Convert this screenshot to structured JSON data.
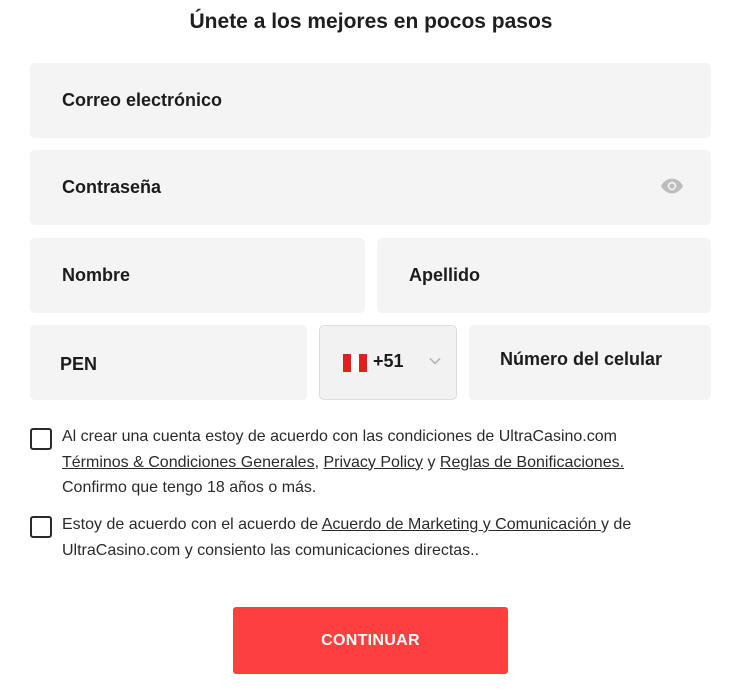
{
  "header": {
    "title": "Únete a los mejores en pocos pasos"
  },
  "form": {
    "email_placeholder": "Correo electrónico",
    "password_placeholder": "Contraseña",
    "first_name_placeholder": "Nombre",
    "last_name_placeholder": "Apellido",
    "currency_value": "PEN",
    "phone_country_code": "+51",
    "phone_country_flag": "peru-flag-icon",
    "phone_placeholder": "Número del celular"
  },
  "consent": {
    "terms_text_1": "Al crear una cuenta estoy de acuerdo con las condiciones de UltraCasino.com",
    "terms_link_1": "Términos & Condiciones Generales",
    "terms_sep_1": ", ",
    "terms_link_2": "Privacy Policy",
    "terms_sep_2": " y ",
    "terms_link_3": "Reglas de Bonificaciones.",
    "terms_text_2": "Confirmo que tengo 18 años o más.",
    "marketing_text_1": "Estoy de acuerdo con el acuerdo de ",
    "marketing_link": "Acuerdo de Marketing y Comunicación ",
    "marketing_text_2": "y de",
    "marketing_text_3": "UltraCasino.com y consiento las comunicaciones directas.."
  },
  "actions": {
    "continue_label": "CONTINUAR"
  },
  "colors": {
    "accent": "#fc3f3f",
    "field_bg": "#f4f4f4",
    "flag_red": "#e0201f"
  }
}
